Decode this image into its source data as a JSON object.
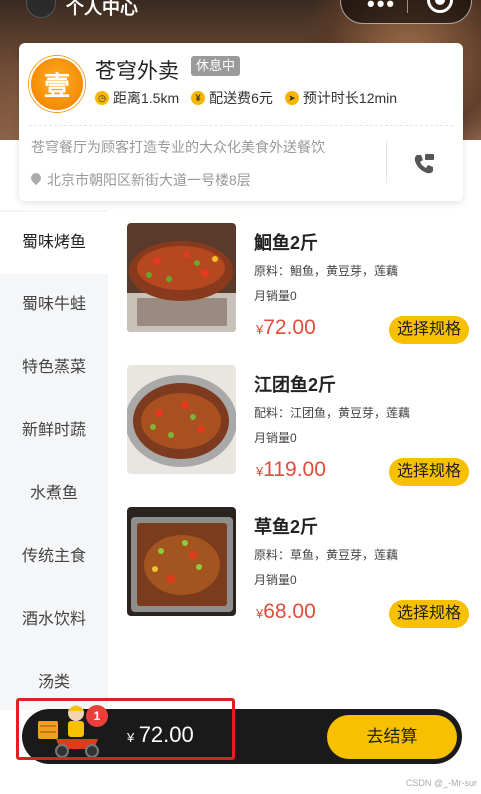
{
  "header": {
    "title": "个人中心"
  },
  "shop": {
    "logo_char": "壹",
    "name": "苍穹外卖",
    "status": "休息中",
    "distance": "距离1.5km",
    "delivery_fee": "配送费6元",
    "eta": "预计时长12min",
    "description": "苍穹餐厅为顾客打造专业的大众化美食外送餐饮",
    "address": "北京市朝阳区新街大道一号楼8层"
  },
  "sidebar": {
    "items": [
      {
        "label": "蜀味烤鱼"
      },
      {
        "label": "蜀味牛蛙"
      },
      {
        "label": "特色蒸菜"
      },
      {
        "label": "新鲜时蔬"
      },
      {
        "label": "水煮鱼"
      },
      {
        "label": "传统主食"
      },
      {
        "label": "酒水饮料"
      },
      {
        "label": "汤类"
      }
    ]
  },
  "dishes": [
    {
      "name": "鮰鱼2斤",
      "ingredients": "原料：鮰鱼，黄豆芽，莲藕",
      "sales": "月销量0",
      "currency": "¥",
      "price": "72.00",
      "button": "选择规格"
    },
    {
      "name": "江团鱼2斤",
      "ingredients": "配料：江团鱼，黄豆芽，莲藕",
      "sales": "月销量0",
      "currency": "¥",
      "price": "119.00",
      "button": "选择规格"
    },
    {
      "name": "草鱼2斤",
      "ingredients": "原料：草鱼，黄豆芽，莲藕",
      "sales": "月销量0",
      "currency": "¥",
      "price": "68.00",
      "button": "选择规格"
    }
  ],
  "cart": {
    "count": "1",
    "currency": "¥",
    "total": "72.00",
    "checkout_label": "去结算"
  },
  "watermark": "CSDN @_-Mr-sur",
  "colors": {
    "accent": "#f7c000",
    "price": "#e24b3b",
    "badge": "#e8413a",
    "highlight": "#e02020"
  }
}
